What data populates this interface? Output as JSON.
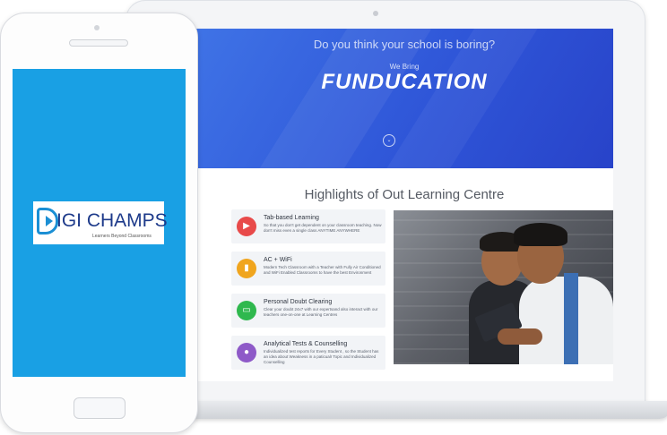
{
  "hero": {
    "question": "Do you think your school is boring?",
    "kicker": "We Bring",
    "title": "FUNDUCATION",
    "scroll_icon": "chevron-down-circle-icon"
  },
  "highlights": {
    "title": "Highlights of Out Learning Centre",
    "items": [
      {
        "title": "Tab-based Learning",
        "desc": "So that you don't get dependent on your classroom teaching. Now don't miss even a single class ANYTIME ANYWHERE",
        "icon": "video-camera-icon",
        "color": "#e84a4a",
        "glyph": "▶"
      },
      {
        "title": "AC + WiFi",
        "desc": "Modern Tech Classroom with a Teacher with Fully Air Conditioned and WiFi Enabled Classrooms to have the best Environment",
        "icon": "bar-chart-icon",
        "color": "#f0a51e",
        "glyph": "▮"
      },
      {
        "title": "Personal Doubt Clearing",
        "desc": "Clear your doubt 24x7 with our expertsand also interact with our teachers one-on-one at Learning Centres",
        "icon": "monitor-icon",
        "color": "#2fb84e",
        "glyph": "▭"
      },
      {
        "title": "Analytical Tests & Counselling",
        "desc": "Individualized test reports for Every Student , so the Student has an idea about Weakness in a paticualr Topic and Individualized Counselling",
        "icon": "user-icon",
        "color": "#8e5ac8",
        "glyph": "●"
      }
    ]
  },
  "logo": {
    "text": "IGI CHAMPS",
    "tagline": "Learners Beyond Classrooms"
  },
  "colors": {
    "hero_start": "#3f73e6",
    "hero_end": "#2843c9",
    "phone_screen": "#19a0e4",
    "logo_blue": "#1d3a8a"
  }
}
